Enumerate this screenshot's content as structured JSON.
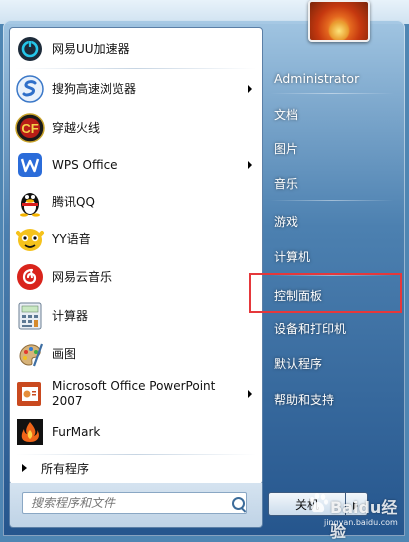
{
  "start_menu": {
    "pinned_items": [
      {
        "label": "网易UU加速器",
        "icon": "uu-accelerator-icon",
        "has_submenu": false
      },
      {
        "label": "搜狗高速浏览器",
        "icon": "sogou-browser-icon",
        "has_submenu": true
      },
      {
        "label": "穿越火线",
        "icon": "crossfire-icon",
        "has_submenu": false
      },
      {
        "label": "WPS Office",
        "icon": "wps-office-icon",
        "has_submenu": true
      },
      {
        "label": "腾讯QQ",
        "icon": "qq-penguin-icon",
        "has_submenu": false
      },
      {
        "label": "YY语音",
        "icon": "yy-voice-icon",
        "has_submenu": false
      },
      {
        "label": "网易云音乐",
        "icon": "netease-music-icon",
        "has_submenu": false
      },
      {
        "label": "计算器",
        "icon": "calculator-icon",
        "has_submenu": false
      },
      {
        "label": "画图",
        "icon": "paint-icon",
        "has_submenu": false
      },
      {
        "label": "Microsoft Office PowerPoint 2007",
        "label_line1": "Microsoft Office PowerPoint",
        "label_line2": "2007",
        "icon": "powerpoint-icon",
        "has_submenu": true
      },
      {
        "label": "FurMark",
        "icon": "furmark-icon",
        "has_submenu": false
      }
    ],
    "all_programs_label": "所有程序",
    "search": {
      "placeholder": "搜索程序和文件",
      "value": ""
    },
    "right_pane": {
      "user_name": "Administrator",
      "items": [
        "文档",
        "图片",
        "音乐",
        "游戏",
        "计算机",
        "控制面板",
        "设备和打印机",
        "默认程序",
        "帮助和支持"
      ],
      "highlighted_item": "控制面板"
    },
    "shutdown_label": "关机"
  },
  "watermark": {
    "brand": "Baidu经验",
    "url": "jingyan.baidu.com"
  },
  "colors": {
    "highlight_border": "#e5383b",
    "menu_glass_top": "#a5c8e4",
    "menu_glass_bottom": "#24548c"
  }
}
